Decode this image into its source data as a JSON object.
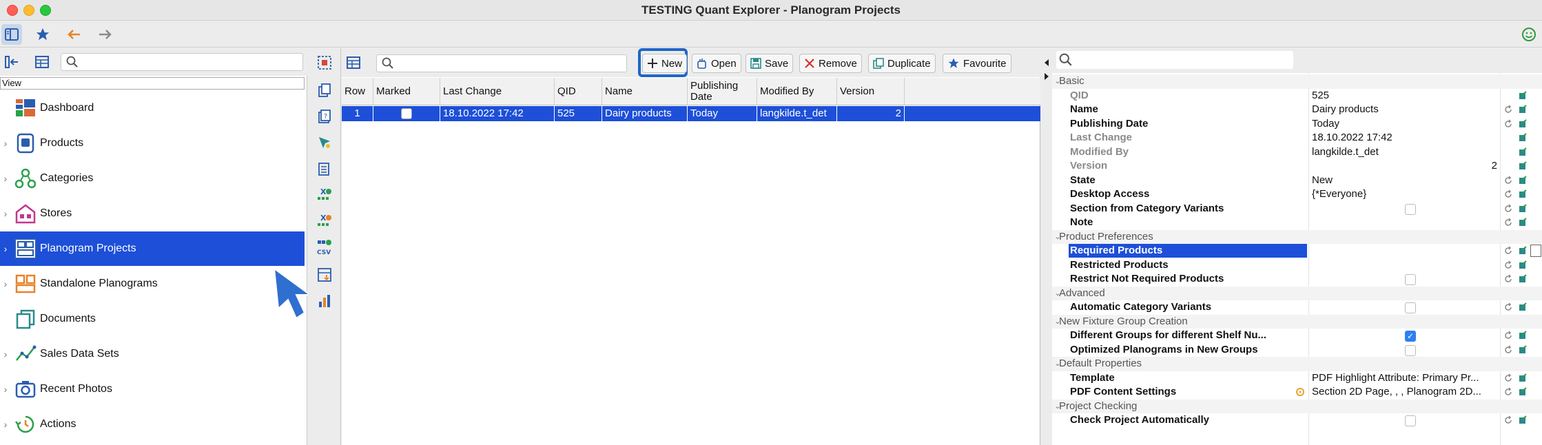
{
  "window": {
    "title": "TESTING Quant Explorer - Planogram Projects"
  },
  "left": {
    "view_label": "View",
    "nav": [
      {
        "label": "Dashboard",
        "icon": "dashboard-icon",
        "chevron": false
      },
      {
        "label": "Products",
        "icon": "products-icon",
        "chevron": true
      },
      {
        "label": "Categories",
        "icon": "categories-icon",
        "chevron": true
      },
      {
        "label": "Stores",
        "icon": "stores-icon",
        "chevron": true
      },
      {
        "label": "Planogram Projects",
        "icon": "planogram-projects-icon",
        "chevron": true,
        "selected": true
      },
      {
        "label": "Standalone Planograms",
        "icon": "standalone-planograms-icon",
        "chevron": true
      },
      {
        "label": "Documents",
        "icon": "documents-icon",
        "chevron": false
      },
      {
        "label": "Sales Data Sets",
        "icon": "sales-data-icon",
        "chevron": true
      },
      {
        "label": "Recent Photos",
        "icon": "camera-icon",
        "chevron": true
      },
      {
        "label": "Actions",
        "icon": "actions-icon",
        "chevron": true
      }
    ]
  },
  "center": {
    "buttons": {
      "new": "New",
      "open": "Open",
      "save": "Save",
      "remove": "Remove",
      "duplicate": "Duplicate",
      "favourite": "Favourite"
    },
    "columns": [
      "Row",
      "Marked",
      "Last Change",
      "QID",
      "Name",
      "Publishing Date",
      "Modified By",
      "Version"
    ],
    "rows": [
      {
        "row": "1",
        "marked": false,
        "last_change": "18.10.2022 17:42",
        "qid": "525",
        "name": "Dairy products",
        "publishing_date": "Today",
        "modified_by": "langkilde.t_det",
        "version": "2"
      }
    ]
  },
  "properties": {
    "rows": [
      {
        "type": "section",
        "key": "Basic"
      },
      {
        "type": "dim",
        "key": "QID",
        "value": "525"
      },
      {
        "type": "bold",
        "key": "Name",
        "value": "Dairy products",
        "reset": true
      },
      {
        "type": "bold",
        "key": "Publishing Date",
        "value": "Today",
        "reset": true
      },
      {
        "type": "dim",
        "key": "Last Change",
        "value": "18.10.2022 17:42"
      },
      {
        "type": "dim",
        "key": "Modified By",
        "value": "langkilde.t_det"
      },
      {
        "type": "dim",
        "key": "Version",
        "value": "2",
        "align": "right"
      },
      {
        "type": "bold",
        "key": "State",
        "value": "New",
        "reset": true
      },
      {
        "type": "bold",
        "key": "Desktop Access",
        "value": "{*Everyone}",
        "reset": true
      },
      {
        "type": "bold",
        "key": "Section from Category Variants",
        "check": "off",
        "reset": true
      },
      {
        "type": "bold",
        "key": "Note",
        "value": "",
        "reset": true
      },
      {
        "type": "section",
        "key": "Product Preferences"
      },
      {
        "type": "bold",
        "key": "Required Products",
        "value": "",
        "reset": true,
        "selected": true
      },
      {
        "type": "bold",
        "key": "Restricted Products",
        "value": "",
        "reset": true
      },
      {
        "type": "bold",
        "key": "Restrict Not Required Products",
        "check": "off",
        "reset": true
      },
      {
        "type": "section",
        "key": "Advanced"
      },
      {
        "type": "bold",
        "key": "Automatic Category Variants",
        "check": "off",
        "reset": true
      },
      {
        "type": "section",
        "key": "New Fixture Group Creation"
      },
      {
        "type": "bold",
        "key": "Different Groups for different Shelf Nu...",
        "check": "on",
        "reset": true
      },
      {
        "type": "bold",
        "key": "Optimized Planograms in New Groups",
        "check": "off",
        "reset": true
      },
      {
        "type": "section",
        "key": "Default Properties"
      },
      {
        "type": "bold",
        "key": "Template",
        "value": "PDF Highlight Attribute: Primary Pr...",
        "reset": true
      },
      {
        "type": "bold",
        "key": "PDF Content Settings",
        "value": "Section 2D Page, , , Planogram 2D...",
        "reset": true,
        "gear": true
      },
      {
        "type": "section",
        "key": "Project Checking"
      },
      {
        "type": "bold",
        "key": "Check Project Automatically",
        "check": "off",
        "reset": true
      }
    ]
  },
  "colors": {
    "selection": "#1d4fd8",
    "highlight": "#1e66c7",
    "arrow": "#2f6fd0"
  }
}
